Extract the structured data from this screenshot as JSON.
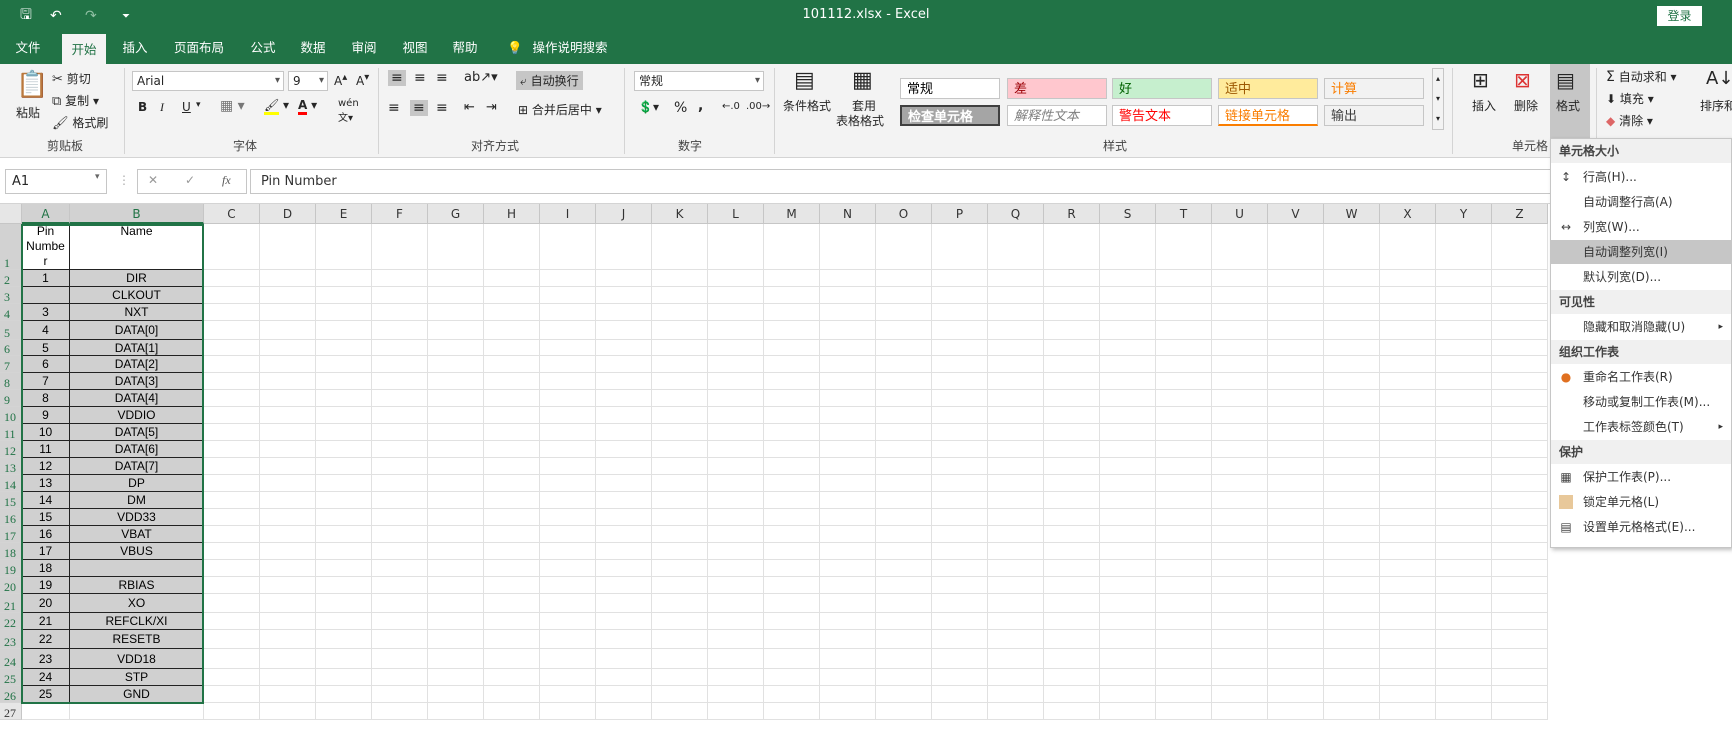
{
  "app": {
    "title": "101112.xlsx  -  Excel",
    "login": "登录"
  },
  "qat": {
    "save": "🖫",
    "undo": "↶",
    "redo": "↷",
    "customize": "⏷"
  },
  "tabs": [
    "文件",
    "开始",
    "插入",
    "页面布局",
    "公式",
    "数据",
    "审阅",
    "视图",
    "帮助",
    "操作说明搜索"
  ],
  "ribbon": {
    "clipboard": {
      "paste": "粘贴",
      "cut": "剪切",
      "copy": "复制",
      "format_painter": "格式刷",
      "label": "剪贴板"
    },
    "font": {
      "name": "Arial",
      "size": "9",
      "bold": "B",
      "italic": "I",
      "underline": "U",
      "label": "字体"
    },
    "alignment": {
      "wrap": "自动换行",
      "merge": "合并后居中",
      "label": "对齐方式"
    },
    "number": {
      "format": "常规",
      "percent": "%",
      "comma": ",",
      "label": "数字"
    },
    "styles": {
      "conditional": "条件格式",
      "table_line1": "套用",
      "table_line2": "表格格式",
      "label": "样式",
      "cells": [
        {
          "text": "常规",
          "bg": "#ffffff",
          "color": "#000000"
        },
        {
          "text": "差",
          "bg": "#ffc7ce",
          "color": "#9c0006"
        },
        {
          "text": "好",
          "bg": "#c6efce",
          "color": "#006100"
        },
        {
          "text": "适中",
          "bg": "#ffeb9c",
          "color": "#9c5700"
        },
        {
          "text": "计算",
          "bg": "#f2f2f2",
          "color": "#fa7d00"
        },
        {
          "text": "检查单元格",
          "bg": "#a5a5a5",
          "color": "#ffffff"
        },
        {
          "text": "解释性文本",
          "bg": "#ffffff",
          "color": "#7f7f7f"
        },
        {
          "text": "警告文本",
          "bg": "#ffffff",
          "color": "#ff0000"
        },
        {
          "text": "链接单元格",
          "bg": "#ffffff",
          "color": "#fa7d00"
        },
        {
          "text": "输出",
          "bg": "#f2f2f2",
          "color": "#3f3f3f"
        }
      ]
    },
    "cells_group": {
      "insert": "插入",
      "delete": "删除",
      "format": "格式",
      "label": "单元格"
    },
    "editing": {
      "autosum": "自动求和",
      "fill": "填充",
      "clear": "清除",
      "sort": "排序和"
    }
  },
  "formula": {
    "name_box": "A1",
    "fx": "fx",
    "content": "Pin Number",
    "cancel": "✕",
    "enter": "✓"
  },
  "columns": [
    "A",
    "B",
    "C",
    "D",
    "E",
    "F",
    "G",
    "H",
    "I",
    "J",
    "K",
    "L",
    "M",
    "N",
    "O",
    "P",
    "Q",
    "R",
    "S",
    "T",
    "U",
    "V",
    "W",
    "X",
    "Y",
    "Z"
  ],
  "rows": [
    {
      "n": "1",
      "a": "Pin\nNumbe\nr",
      "b": "Name"
    },
    {
      "n": "2",
      "a": "1",
      "b": "DIR"
    },
    {
      "n": "3",
      "a": "",
      "b": "CLKOUT"
    },
    {
      "n": "4",
      "a": "3",
      "b": "NXT"
    },
    {
      "n": "5",
      "a": "4",
      "b": "DATA[0]"
    },
    {
      "n": "6",
      "a": "5",
      "b": "DATA[1]"
    },
    {
      "n": "7",
      "a": "6",
      "b": "DATA[2]"
    },
    {
      "n": "8",
      "a": "7",
      "b": "DATA[3]"
    },
    {
      "n": "9",
      "a": "8",
      "b": "DATA[4]"
    },
    {
      "n": "10",
      "a": "9",
      "b": "VDDIO"
    },
    {
      "n": "11",
      "a": "10",
      "b": "DATA[5]"
    },
    {
      "n": "12",
      "a": "11",
      "b": "DATA[6]"
    },
    {
      "n": "13",
      "a": "12",
      "b": "DATA[7]"
    },
    {
      "n": "14",
      "a": "13",
      "b": "DP"
    },
    {
      "n": "15",
      "a": "14",
      "b": "DM"
    },
    {
      "n": "16",
      "a": "15",
      "b": "VDD33"
    },
    {
      "n": "17",
      "a": "16",
      "b": "VBAT"
    },
    {
      "n": "18",
      "a": "17",
      "b": "VBUS"
    },
    {
      "n": "19",
      "a": "18",
      "b": ""
    },
    {
      "n": "20",
      "a": "19",
      "b": "RBIAS"
    },
    {
      "n": "21",
      "a": "20",
      "b": "XO"
    },
    {
      "n": "22",
      "a": "21",
      "b": "REFCLK/XI"
    },
    {
      "n": "23",
      "a": "22",
      "b": "RESETB"
    },
    {
      "n": "24",
      "a": "23",
      "b": "VDD18"
    },
    {
      "n": "25",
      "a": "24",
      "b": "STP"
    },
    {
      "n": "26",
      "a": "25",
      "b": "GND"
    },
    {
      "n": "27",
      "a": "",
      "b": ""
    }
  ],
  "menu": {
    "h1": "单元格大小",
    "row_height": "行高(H)...",
    "autofit_row": "自动调整行高(A)",
    "col_width": "列宽(W)...",
    "autofit_col": "自动调整列宽(I)",
    "default_width": "默认列宽(D)...",
    "h2": "可见性",
    "hide": "隐藏和取消隐藏(U)",
    "h3": "组织工作表",
    "rename": "重命名工作表(R)",
    "move_copy": "移动或复制工作表(M)...",
    "tab_color": "工作表标签颜色(T)",
    "h4": "保护",
    "protect": "保护工作表(P)...",
    "lock": "锁定单元格(L)",
    "format_cells": "设置单元格格式(E)..."
  }
}
